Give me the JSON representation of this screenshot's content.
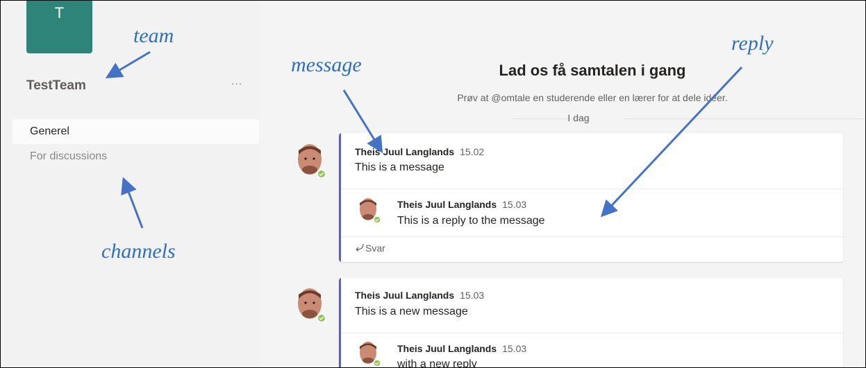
{
  "team": {
    "tile_letter": "T",
    "name": "TestTeam",
    "more": "...",
    "color": "#2e8479"
  },
  "channels": [
    {
      "label": "Generel",
      "active": true
    },
    {
      "label": "For discussions",
      "active": false
    }
  ],
  "conversation": {
    "title": "Lad os få samtalen i gang",
    "subtitle": "Prøv at @omtale en studerende eller en lærer for at dele idéer.",
    "date_label": "I dag",
    "accent": "#6264a7"
  },
  "threads": [
    {
      "author": "Theis Juul Langlands",
      "time": "15.02",
      "text": "This is a message",
      "reply": {
        "author": "Theis Juul Langlands",
        "time": "15.03",
        "text": "This is a reply to the message"
      },
      "reply_action": "Svar",
      "reply_action_icon": "reply-arrow-icon"
    },
    {
      "author": "Theis Juul Langlands",
      "time": "15.03",
      "text": "This is a new message",
      "reply": {
        "author": "Theis Juul Langlands",
        "time": "15.03",
        "text": "with a new reply"
      }
    }
  ],
  "annotations": {
    "team": "team",
    "message": "message",
    "reply": "reply",
    "channels": "channels",
    "color": "#2e6fc0"
  }
}
